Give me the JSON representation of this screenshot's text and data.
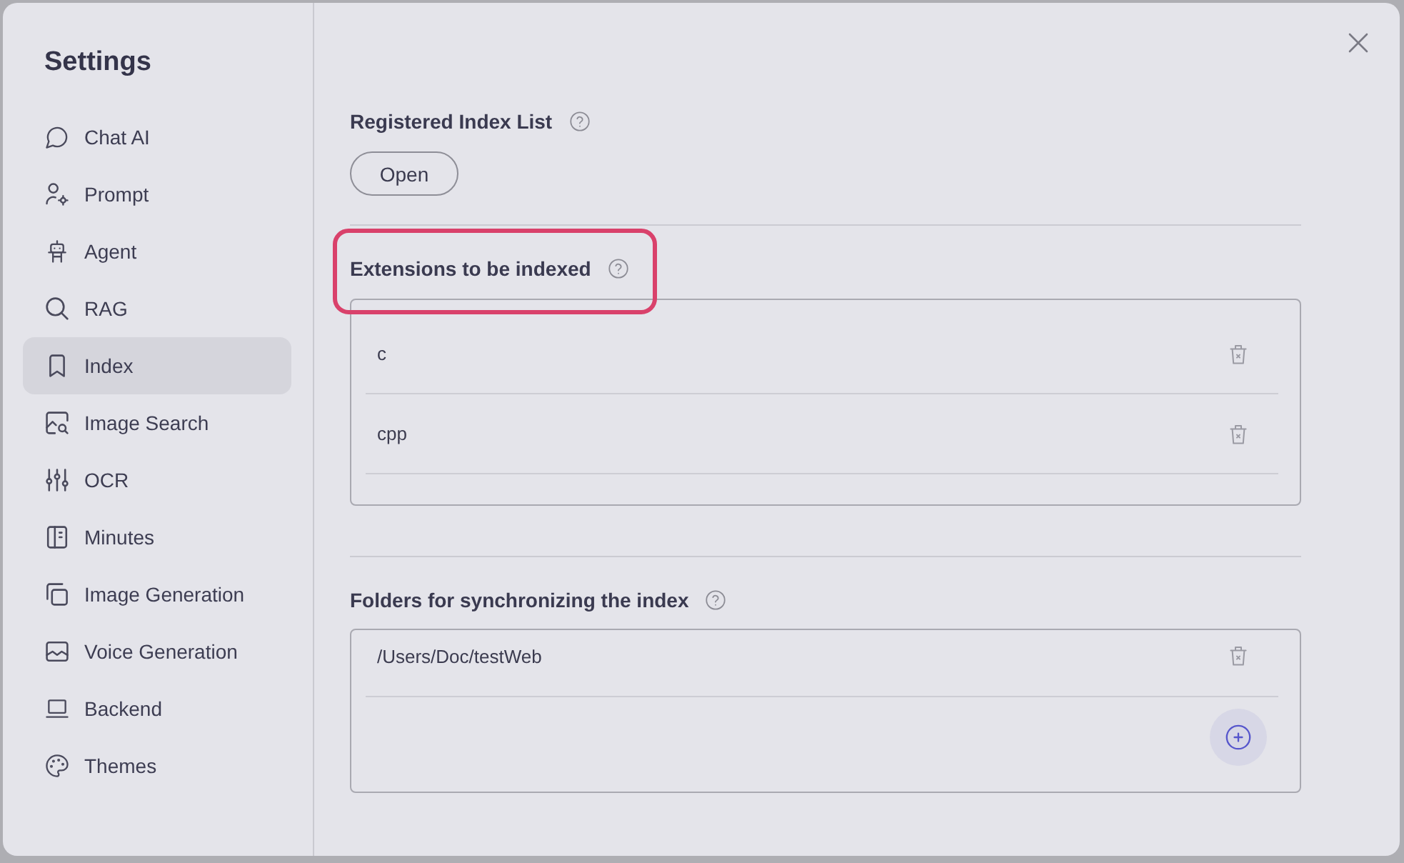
{
  "sidebar": {
    "title": "Settings",
    "items": [
      {
        "label": "Chat AI",
        "selected": false
      },
      {
        "label": "Prompt",
        "selected": false
      },
      {
        "label": "Agent",
        "selected": false
      },
      {
        "label": "RAG",
        "selected": false
      },
      {
        "label": "Index",
        "selected": true
      },
      {
        "label": "Image Search",
        "selected": false
      },
      {
        "label": "OCR",
        "selected": false
      },
      {
        "label": "Minutes",
        "selected": false
      },
      {
        "label": "Image Generation",
        "selected": false
      },
      {
        "label": "Voice Generation",
        "selected": false
      },
      {
        "label": "Backend",
        "selected": false
      },
      {
        "label": "Themes",
        "selected": false
      }
    ]
  },
  "main": {
    "sections": [
      {
        "kind": "button",
        "title": "Registered Index List",
        "highlighted": false,
        "button": "Open"
      },
      {
        "kind": "list",
        "title": "Extensions to be indexed",
        "highlighted": true,
        "items": [
          "c",
          "cpp"
        ]
      },
      {
        "kind": "folder_list",
        "title": "Folders for synchronizing the index",
        "highlighted": false,
        "items": [
          "/Users/Doc/testWeb"
        ]
      }
    ]
  }
}
